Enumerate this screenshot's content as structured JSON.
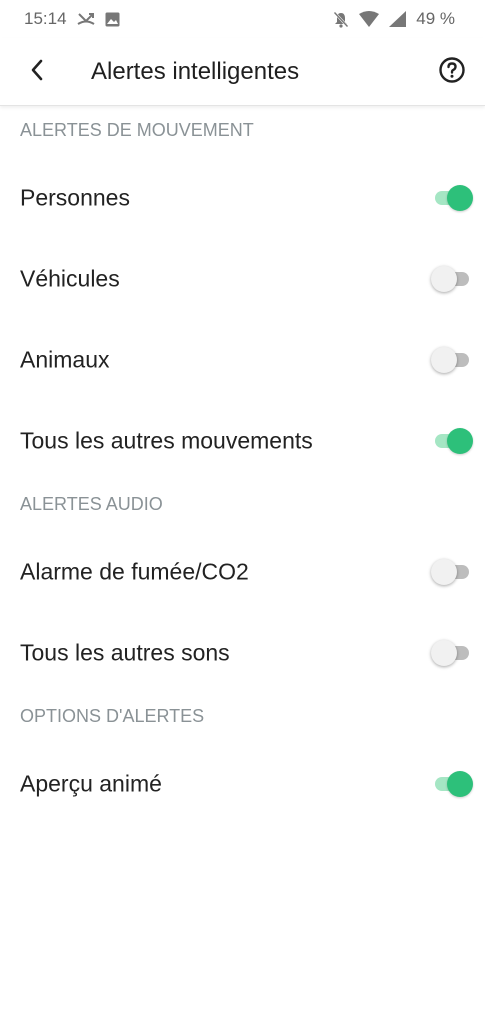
{
  "status_bar": {
    "time": "15:14",
    "battery": "49 %"
  },
  "header": {
    "title": "Alertes intelligentes",
    "back_icon": "chevron-left-icon",
    "help_icon": "help-circle-icon"
  },
  "sections": {
    "motion": {
      "title": "ALERTES DE MOUVEMENT",
      "items": [
        {
          "label": "Personnes",
          "enabled": true
        },
        {
          "label": "Véhicules",
          "enabled": false
        },
        {
          "label": "Animaux",
          "enabled": false
        },
        {
          "label": "Tous les autres mouvements",
          "enabled": true
        }
      ]
    },
    "audio": {
      "title": "ALERTES AUDIO",
      "items": [
        {
          "label": "Alarme de fumée/CO2",
          "enabled": false
        },
        {
          "label": "Tous les autres sons",
          "enabled": false
        }
      ]
    },
    "options": {
      "title": "OPTIONS D'ALERTES",
      "items": [
        {
          "label": "Aperçu animé",
          "enabled": true
        }
      ]
    }
  },
  "colors": {
    "toggle_on": "#2dc07a",
    "toggle_on_track": "#a5e6c4",
    "toggle_off_track": "#bdbdbd",
    "section_header": "#8a9296"
  }
}
